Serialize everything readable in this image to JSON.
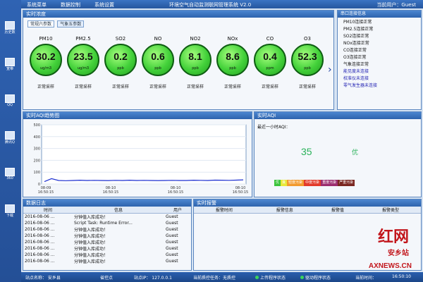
{
  "desktop": {
    "icons": [
      {
        "label": "历史数",
        "icon": "folder-icon"
      },
      {
        "label": "宽带",
        "icon": "network-icon"
      },
      {
        "label": "QQ",
        "icon": "qq-icon"
      },
      {
        "label": "腾讯Q",
        "icon": "app-icon"
      },
      {
        "label": "360",
        "icon": "app-icon"
      },
      {
        "label": "下载",
        "icon": "app-icon"
      }
    ]
  },
  "menubar": {
    "items": [
      "系统菜单",
      "数据控制",
      "系统设置"
    ],
    "title": "环境空气自动监测联网管理系统 V2.0",
    "user": "当前用户：Guest"
  },
  "realtime_panel": {
    "title": "实时浓度",
    "tabs": [
      "常规六参数",
      "气象五参数"
    ],
    "gauges": [
      {
        "name": "PM10",
        "value": "30.2",
        "unit": "ug/m3",
        "status": "正常采样"
      },
      {
        "name": "PM2.5",
        "value": "23.5",
        "unit": "ug/m3",
        "status": "正常采样"
      },
      {
        "name": "SO2",
        "value": "0.2",
        "unit": "ppb",
        "status": "正常采样"
      },
      {
        "name": "NO",
        "value": "0.6",
        "unit": "ppb",
        "status": "正常采样"
      },
      {
        "name": "NO2",
        "value": "8.1",
        "unit": "ppb",
        "status": "正常采样"
      },
      {
        "name": "NOx",
        "value": "8.6",
        "unit": "ppb",
        "status": "正常采样"
      },
      {
        "name": "CO",
        "value": "0.4",
        "unit": "ppm",
        "status": "正常采样"
      },
      {
        "name": "O3",
        "value": "52.3",
        "unit": "ppb",
        "status": "正常采样"
      }
    ],
    "next_arrow": "›"
  },
  "serial_panel": {
    "title": "串口连接信息",
    "lines": [
      {
        "text": "PM10连接正常",
        "warn": false
      },
      {
        "text": "PM2.5连接正常",
        "warn": false
      },
      {
        "text": "SO2连接正常",
        "warn": false
      },
      {
        "text": "NOx连接正常",
        "warn": false
      },
      {
        "text": "CO连接正常",
        "warn": false
      },
      {
        "text": "O3连接正常",
        "warn": false
      },
      {
        "text": "气象连接正常",
        "warn": false
      },
      {
        "text": "能见度未连接",
        "warn": true
      },
      {
        "text": "校准仪未连接",
        "warn": true
      },
      {
        "text": "零气发生器未连接",
        "warn": true
      }
    ]
  },
  "trend_panel": {
    "title": "实时AQI趋势图",
    "y_ticks": [
      "500",
      "400",
      "300",
      "200",
      "100",
      "0"
    ],
    "x_ticks": [
      "08-09\n16:50:15",
      "08-10\n16:50:15",
      "08-10\n16:50:15",
      "08-10\n16:50:15"
    ]
  },
  "chart_data": {
    "type": "line",
    "ylim": [
      0,
      500
    ],
    "series": [
      {
        "values": [
          20,
          45,
          30,
          28,
          30,
          32,
          30,
          31,
          30,
          29,
          31,
          30,
          32,
          30,
          31,
          30,
          29,
          30,
          31,
          30,
          30,
          32,
          31,
          30,
          33,
          32,
          31,
          33,
          35
        ]
      }
    ]
  },
  "aqi_panel": {
    "title": "实时AQI",
    "label": "最近一小时AQI：",
    "value": "35",
    "level": "优",
    "legend": [
      {
        "text": "优",
        "color": "#3cc43c"
      },
      {
        "text": "良",
        "color": "#e8e83a"
      },
      {
        "text": "轻度污染",
        "color": "#f29a2e"
      },
      {
        "text": "中度污染",
        "color": "#e23a2a"
      },
      {
        "text": "重度污染",
        "color": "#9b2c6e"
      },
      {
        "text": "严重污染",
        "color": "#7a2620"
      }
    ]
  },
  "log_panel": {
    "title": "数据日志",
    "headers": [
      "时间",
      "信息",
      "用户"
    ],
    "rows": [
      [
        "2016-08-06 ...",
        "分钟值入库成功！",
        "Guest"
      ],
      [
        "2016-08-06 ...",
        "Script Task: Runtime Error...",
        "Guest"
      ],
      [
        "2016-08-06 ...",
        "分钟值入库成功！",
        "Guest"
      ],
      [
        "2016-08-06 ...",
        "分钟值入库成功！",
        "Guest"
      ],
      [
        "2016-08-06 ...",
        "分钟值入库成功！",
        "Guest"
      ],
      [
        "2016-08-06 ...",
        "分钟值入库成功！",
        "Guest"
      ],
      [
        "2016-08-06 ...",
        "分钟值入库成功！",
        "Guest"
      ],
      [
        "2016-08-06 ...",
        "分钟值入库成功！",
        "Guest"
      ]
    ]
  },
  "alarm_panel": {
    "title": "实时报警",
    "headers": [
      "报警时间",
      "报警信息",
      "报警值",
      "报警类型"
    ]
  },
  "statusbar": {
    "station": "站点名称： 安乡县",
    "level": "省控点",
    "ip": "站点IP： 127.0.0.1",
    "task": "当前质控任务：无质控",
    "upload": "上传程序状态",
    "driver": "驱动程序状态",
    "time_label": "当前时间：",
    "time": "16:50:10"
  },
  "watermark": {
    "logo": "红网",
    "station": "安乡站",
    "url": "AXNEWS.CN"
  }
}
